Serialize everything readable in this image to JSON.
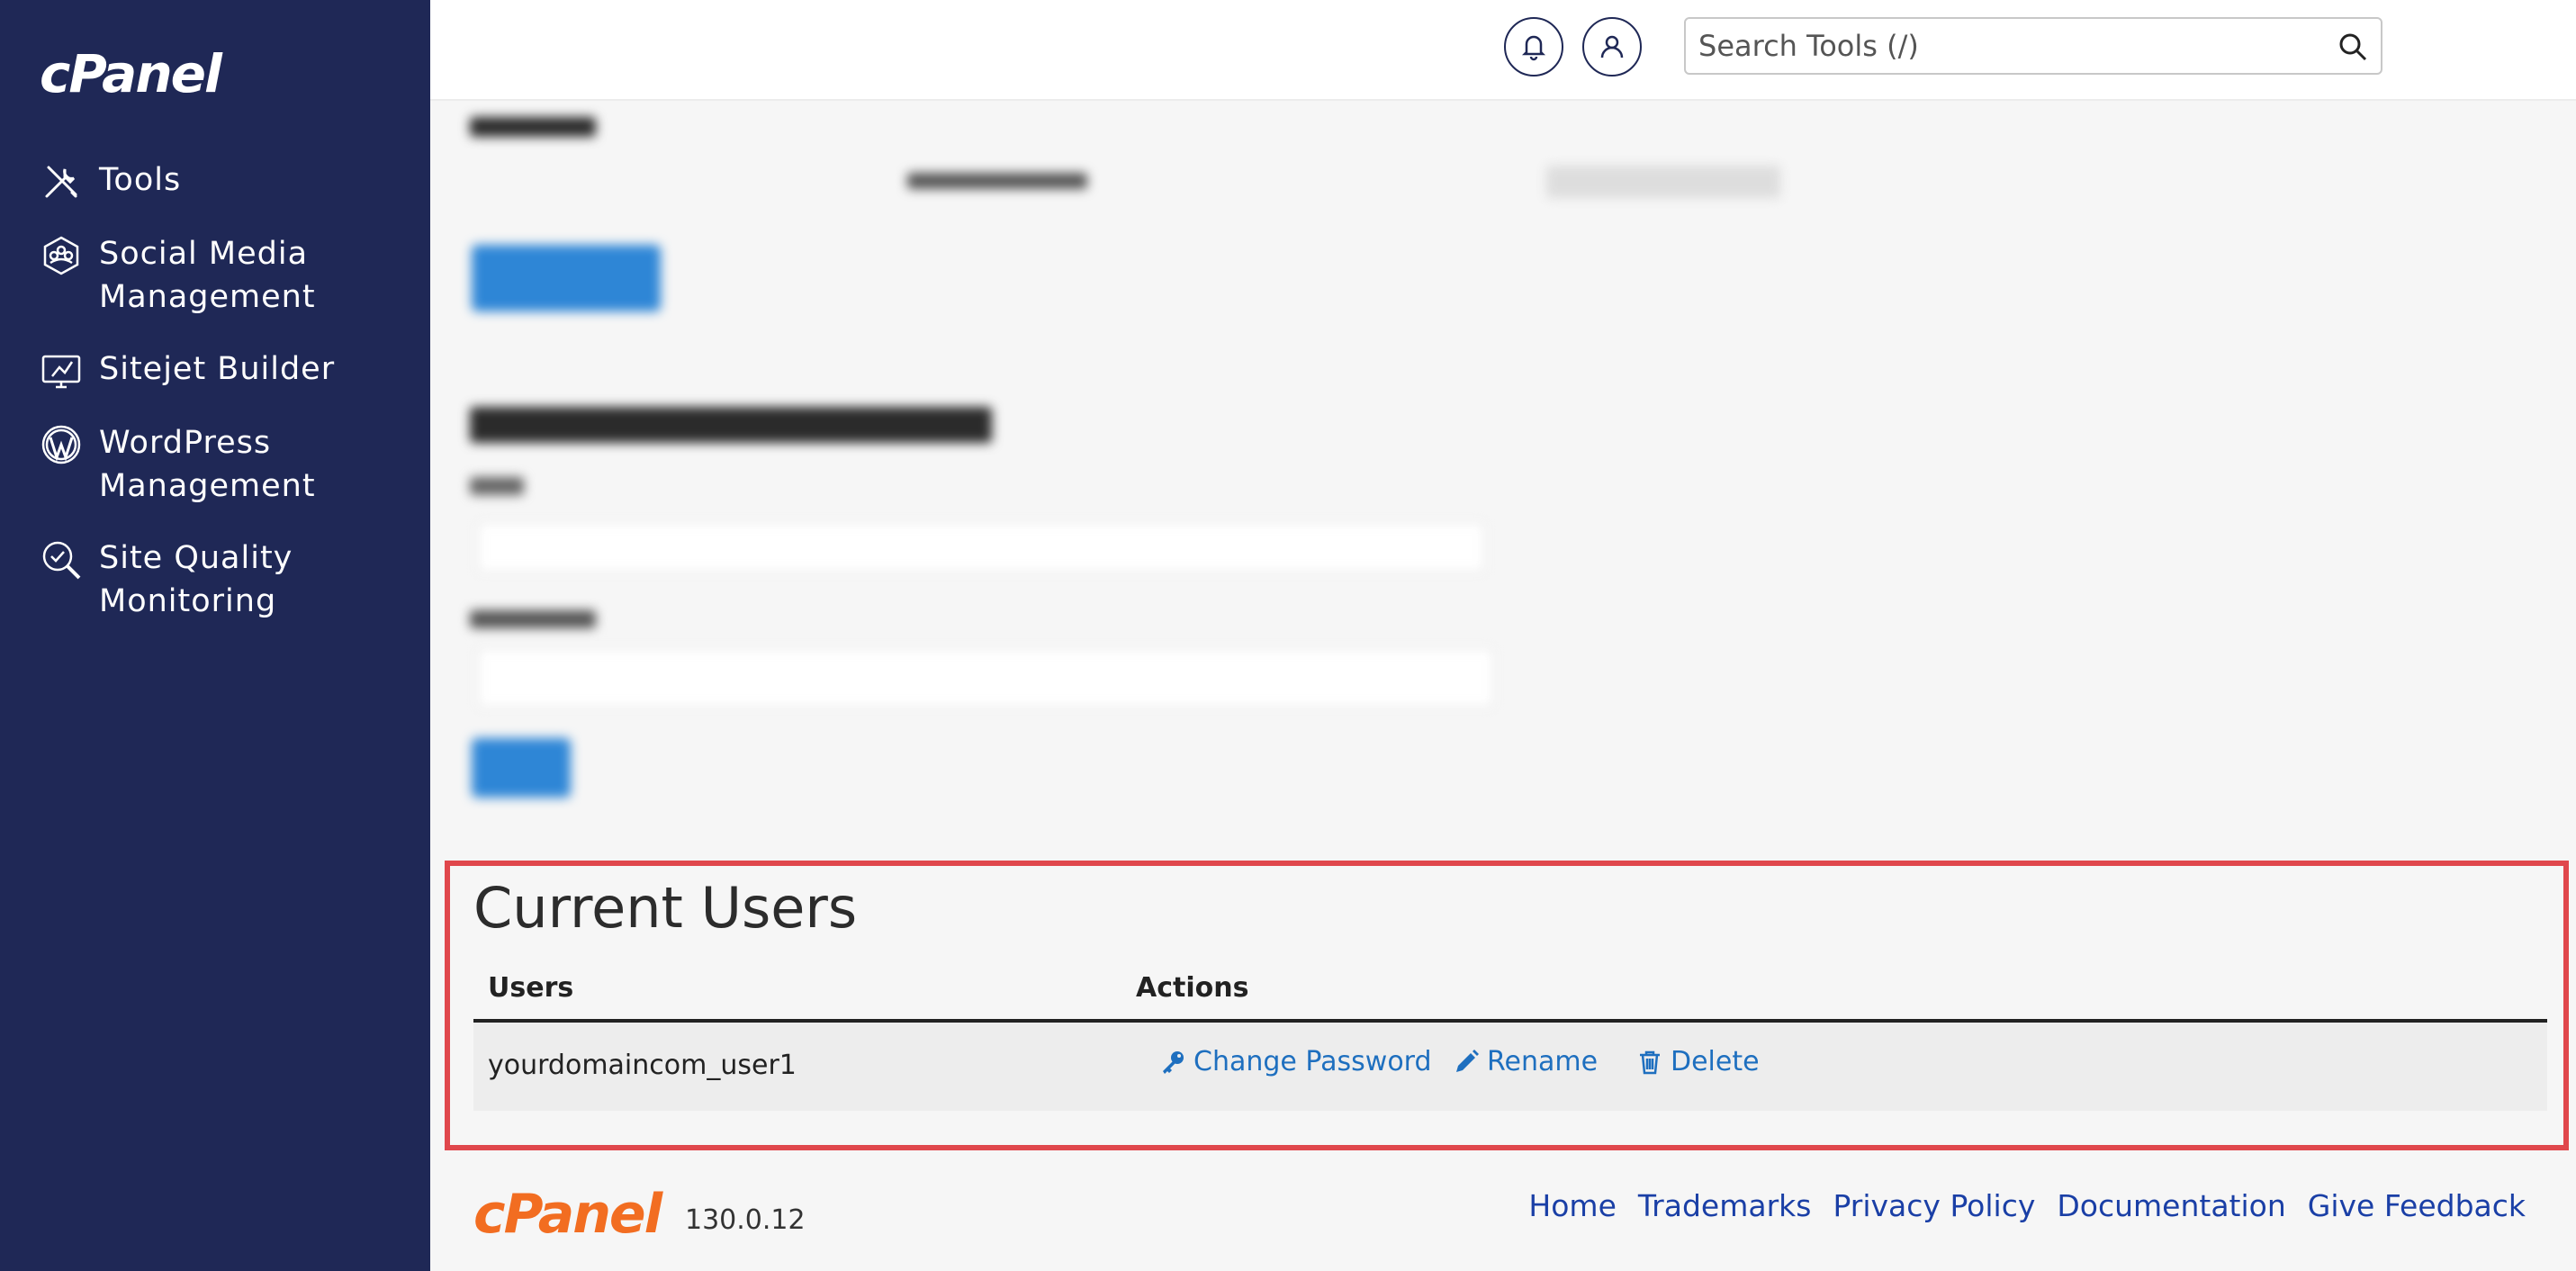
{
  "brand": {
    "logo_text": "cPanel"
  },
  "sidebar": {
    "items": [
      {
        "label": "Tools",
        "icon": "tools-icon"
      },
      {
        "label": "Social Media\nManagement",
        "icon": "social-media-icon"
      },
      {
        "label": "Sitejet Builder",
        "icon": "sitejet-icon"
      },
      {
        "label": "WordPress\nManagement",
        "icon": "wordpress-icon"
      },
      {
        "label": "Site Quality\nMonitoring",
        "icon": "site-quality-icon"
      }
    ]
  },
  "header": {
    "search_placeholder": "Search Tools (/)",
    "icons": [
      "search-icon",
      "bell-icon",
      "user-icon"
    ]
  },
  "current_users": {
    "title": "Current Users",
    "columns": [
      "Users",
      "Actions"
    ],
    "rows": [
      {
        "user": "yourdomaincom_user1",
        "actions": [
          {
            "label": "Change Password",
            "icon": "key-icon"
          },
          {
            "label": "Rename",
            "icon": "pencil-icon"
          },
          {
            "label": "Delete",
            "icon": "trash-icon"
          }
        ]
      }
    ]
  },
  "footer": {
    "logo_text": "cPanel",
    "version": "130.0.12",
    "links": [
      "Home",
      "Trademarks",
      "Privacy Policy",
      "Documentation",
      "Give Feedback"
    ]
  },
  "colors": {
    "sidebar_bg": "#1f2856",
    "link": "#1e6fbf",
    "highlight": "#e0474c",
    "footer_logo": "#f26d21"
  }
}
